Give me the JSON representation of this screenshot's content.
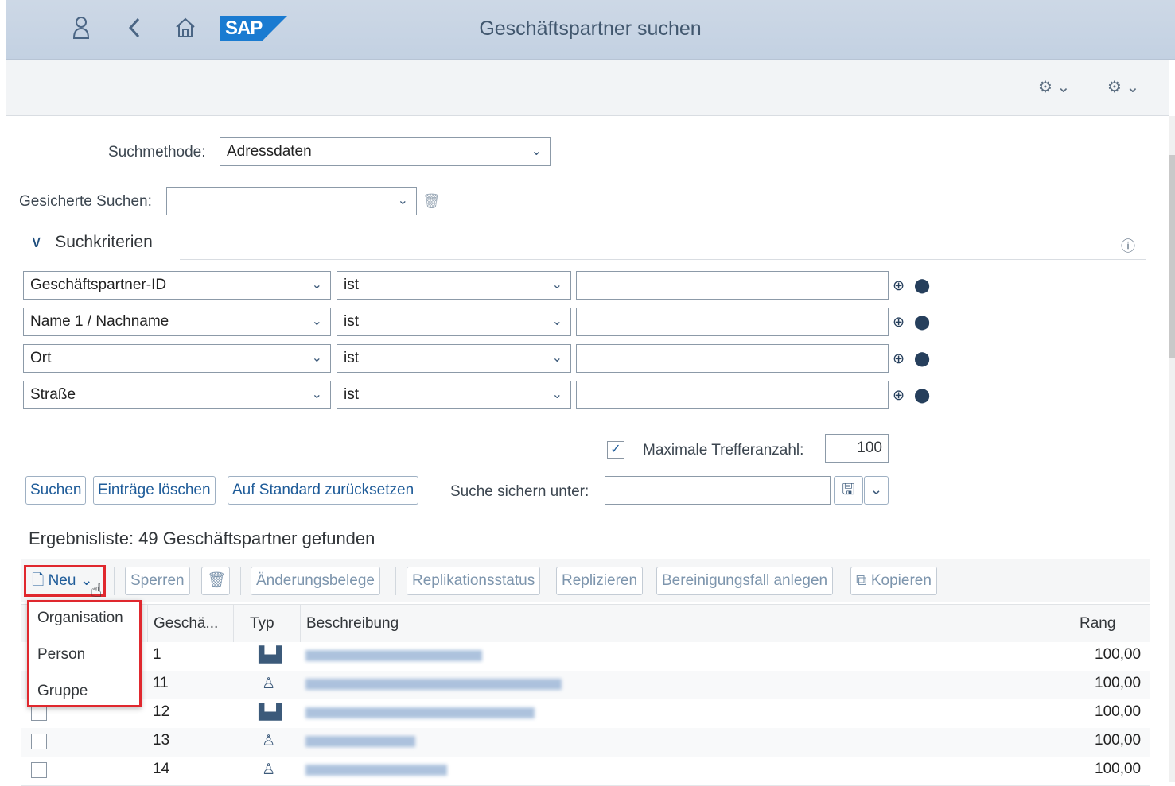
{
  "shell": {
    "title": "Geschäftspartner suchen",
    "logo": "SAP"
  },
  "search": {
    "method_label": "Suchmethode:",
    "method_value": "Adressdaten",
    "saved_label": "Gesicherte Suchen:",
    "saved_value": "",
    "criteria_title": "Suchkriterien",
    "criteria": [
      {
        "field": "Geschäftspartner-ID",
        "operator": "ist",
        "value": ""
      },
      {
        "field": "Name 1 / Nachname",
        "operator": "ist",
        "value": ""
      },
      {
        "field": "Ort",
        "operator": "ist",
        "value": ""
      },
      {
        "field": "Straße",
        "operator": "ist",
        "value": ""
      }
    ],
    "max_hits_label": "Maximale Trefferanzahl:",
    "max_hits_value": "100",
    "max_hits_checked": true,
    "buttons": {
      "search": "Suchen",
      "clear": "Einträge löschen",
      "reset": "Auf Standard zurücksetzen"
    },
    "save_label": "Suche sichern unter:",
    "save_value": ""
  },
  "results": {
    "title": "Ergebnisliste: 49 Geschäftspartner gefunden",
    "toolbar": {
      "new": "Neu",
      "lock": "Sperren",
      "change_docs": "Änderungsbelege",
      "replication_status": "Replikationsstatus",
      "replicate": "Replizieren",
      "cleanup": "Bereinigungsfall anlegen",
      "copy": "Kopieren"
    },
    "new_menu": [
      "Organisation",
      "Person",
      "Gruppe"
    ],
    "columns": {
      "id": "Geschä...",
      "type": "Typ",
      "description": "Beschreibung",
      "rank": "Rang"
    },
    "rows": [
      {
        "id": "1",
        "type": "organization-icon",
        "rank": "100,00"
      },
      {
        "id": "11",
        "type": "person-icon",
        "rank": "100,00"
      },
      {
        "id": "12",
        "type": "organization-icon",
        "rank": "100,00"
      },
      {
        "id": "13",
        "type": "person-icon",
        "rank": "100,00"
      },
      {
        "id": "14",
        "type": "person-icon",
        "rank": "100,00"
      }
    ]
  },
  "colors": {
    "shell": "#c8d5e5",
    "link": "#1f5c99",
    "highlight": "#e0282e"
  }
}
